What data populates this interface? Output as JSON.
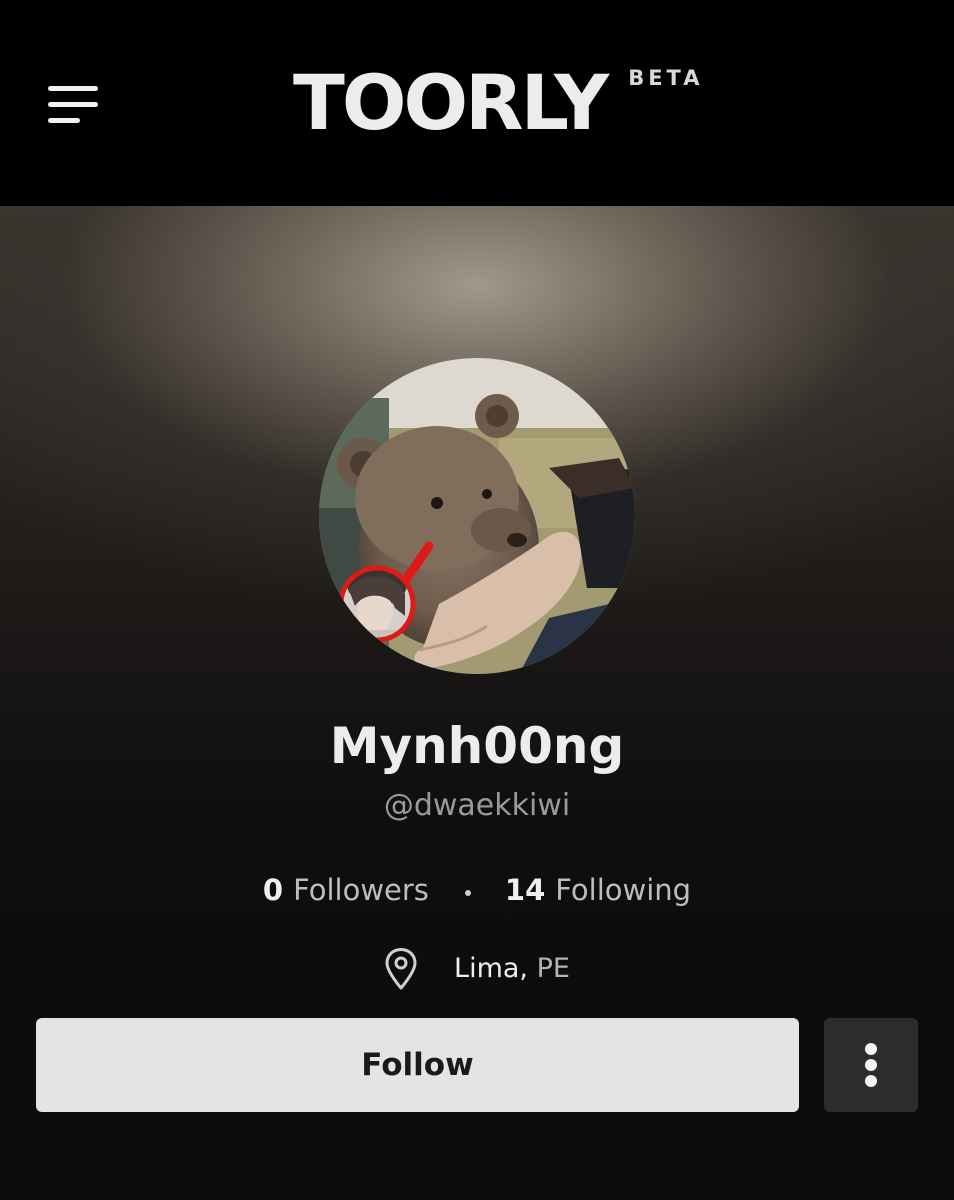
{
  "header": {
    "logo_text": "TOORLY",
    "beta_label": "BETA",
    "menu_icon": "hamburger-menu-icon"
  },
  "profile": {
    "display_name": "Mynh00ng",
    "handle": "@dwaekkiwi",
    "followers_count": "0",
    "followers_label": "Followers",
    "following_count": "14",
    "following_label": "Following",
    "location_city": "Lima,",
    "location_country": "PE",
    "location_icon": "map-pin-icon"
  },
  "actions": {
    "follow_label": "Follow",
    "more_icon": "vertical-dots-icon"
  },
  "colors": {
    "header_bg": "#000000",
    "page_bg": "#0b0b0b",
    "follow_button_bg": "#e4e4e4",
    "more_button_bg": "#2c2c2c",
    "avatar_badge_ring": "#e01818"
  }
}
